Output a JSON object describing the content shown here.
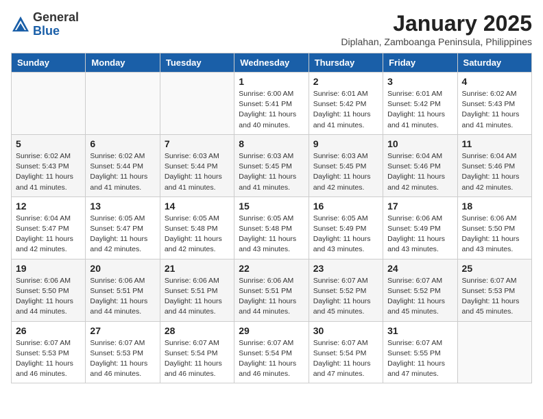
{
  "header": {
    "logo": {
      "general": "General",
      "blue": "Blue"
    },
    "title": "January 2025",
    "location": "Diplahan, Zamboanga Peninsula, Philippines"
  },
  "weekdays": [
    "Sunday",
    "Monday",
    "Tuesday",
    "Wednesday",
    "Thursday",
    "Friday",
    "Saturday"
  ],
  "weeks": [
    [
      {
        "day": "",
        "sunrise": "",
        "sunset": "",
        "daylight": "",
        "empty": true
      },
      {
        "day": "",
        "sunrise": "",
        "sunset": "",
        "daylight": "",
        "empty": true
      },
      {
        "day": "",
        "sunrise": "",
        "sunset": "",
        "daylight": "",
        "empty": true
      },
      {
        "day": "1",
        "sunrise": "Sunrise: 6:00 AM",
        "sunset": "Sunset: 5:41 PM",
        "daylight": "Daylight: 11 hours and 40 minutes."
      },
      {
        "day": "2",
        "sunrise": "Sunrise: 6:01 AM",
        "sunset": "Sunset: 5:42 PM",
        "daylight": "Daylight: 11 hours and 41 minutes."
      },
      {
        "day": "3",
        "sunrise": "Sunrise: 6:01 AM",
        "sunset": "Sunset: 5:42 PM",
        "daylight": "Daylight: 11 hours and 41 minutes."
      },
      {
        "day": "4",
        "sunrise": "Sunrise: 6:02 AM",
        "sunset": "Sunset: 5:43 PM",
        "daylight": "Daylight: 11 hours and 41 minutes."
      }
    ],
    [
      {
        "day": "5",
        "sunrise": "Sunrise: 6:02 AM",
        "sunset": "Sunset: 5:43 PM",
        "daylight": "Daylight: 11 hours and 41 minutes."
      },
      {
        "day": "6",
        "sunrise": "Sunrise: 6:02 AM",
        "sunset": "Sunset: 5:44 PM",
        "daylight": "Daylight: 11 hours and 41 minutes."
      },
      {
        "day": "7",
        "sunrise": "Sunrise: 6:03 AM",
        "sunset": "Sunset: 5:44 PM",
        "daylight": "Daylight: 11 hours and 41 minutes."
      },
      {
        "day": "8",
        "sunrise": "Sunrise: 6:03 AM",
        "sunset": "Sunset: 5:45 PM",
        "daylight": "Daylight: 11 hours and 41 minutes."
      },
      {
        "day": "9",
        "sunrise": "Sunrise: 6:03 AM",
        "sunset": "Sunset: 5:45 PM",
        "daylight": "Daylight: 11 hours and 42 minutes."
      },
      {
        "day": "10",
        "sunrise": "Sunrise: 6:04 AM",
        "sunset": "Sunset: 5:46 PM",
        "daylight": "Daylight: 11 hours and 42 minutes."
      },
      {
        "day": "11",
        "sunrise": "Sunrise: 6:04 AM",
        "sunset": "Sunset: 5:46 PM",
        "daylight": "Daylight: 11 hours and 42 minutes."
      }
    ],
    [
      {
        "day": "12",
        "sunrise": "Sunrise: 6:04 AM",
        "sunset": "Sunset: 5:47 PM",
        "daylight": "Daylight: 11 hours and 42 minutes."
      },
      {
        "day": "13",
        "sunrise": "Sunrise: 6:05 AM",
        "sunset": "Sunset: 5:47 PM",
        "daylight": "Daylight: 11 hours and 42 minutes."
      },
      {
        "day": "14",
        "sunrise": "Sunrise: 6:05 AM",
        "sunset": "Sunset: 5:48 PM",
        "daylight": "Daylight: 11 hours and 42 minutes."
      },
      {
        "day": "15",
        "sunrise": "Sunrise: 6:05 AM",
        "sunset": "Sunset: 5:48 PM",
        "daylight": "Daylight: 11 hours and 43 minutes."
      },
      {
        "day": "16",
        "sunrise": "Sunrise: 6:05 AM",
        "sunset": "Sunset: 5:49 PM",
        "daylight": "Daylight: 11 hours and 43 minutes."
      },
      {
        "day": "17",
        "sunrise": "Sunrise: 6:06 AM",
        "sunset": "Sunset: 5:49 PM",
        "daylight": "Daylight: 11 hours and 43 minutes."
      },
      {
        "day": "18",
        "sunrise": "Sunrise: 6:06 AM",
        "sunset": "Sunset: 5:50 PM",
        "daylight": "Daylight: 11 hours and 43 minutes."
      }
    ],
    [
      {
        "day": "19",
        "sunrise": "Sunrise: 6:06 AM",
        "sunset": "Sunset: 5:50 PM",
        "daylight": "Daylight: 11 hours and 44 minutes."
      },
      {
        "day": "20",
        "sunrise": "Sunrise: 6:06 AM",
        "sunset": "Sunset: 5:51 PM",
        "daylight": "Daylight: 11 hours and 44 minutes."
      },
      {
        "day": "21",
        "sunrise": "Sunrise: 6:06 AM",
        "sunset": "Sunset: 5:51 PM",
        "daylight": "Daylight: 11 hours and 44 minutes."
      },
      {
        "day": "22",
        "sunrise": "Sunrise: 6:06 AM",
        "sunset": "Sunset: 5:51 PM",
        "daylight": "Daylight: 11 hours and 44 minutes."
      },
      {
        "day": "23",
        "sunrise": "Sunrise: 6:07 AM",
        "sunset": "Sunset: 5:52 PM",
        "daylight": "Daylight: 11 hours and 45 minutes."
      },
      {
        "day": "24",
        "sunrise": "Sunrise: 6:07 AM",
        "sunset": "Sunset: 5:52 PM",
        "daylight": "Daylight: 11 hours and 45 minutes."
      },
      {
        "day": "25",
        "sunrise": "Sunrise: 6:07 AM",
        "sunset": "Sunset: 5:53 PM",
        "daylight": "Daylight: 11 hours and 45 minutes."
      }
    ],
    [
      {
        "day": "26",
        "sunrise": "Sunrise: 6:07 AM",
        "sunset": "Sunset: 5:53 PM",
        "daylight": "Daylight: 11 hours and 46 minutes."
      },
      {
        "day": "27",
        "sunrise": "Sunrise: 6:07 AM",
        "sunset": "Sunset: 5:53 PM",
        "daylight": "Daylight: 11 hours and 46 minutes."
      },
      {
        "day": "28",
        "sunrise": "Sunrise: 6:07 AM",
        "sunset": "Sunset: 5:54 PM",
        "daylight": "Daylight: 11 hours and 46 minutes."
      },
      {
        "day": "29",
        "sunrise": "Sunrise: 6:07 AM",
        "sunset": "Sunset: 5:54 PM",
        "daylight": "Daylight: 11 hours and 46 minutes."
      },
      {
        "day": "30",
        "sunrise": "Sunrise: 6:07 AM",
        "sunset": "Sunset: 5:54 PM",
        "daylight": "Daylight: 11 hours and 47 minutes."
      },
      {
        "day": "31",
        "sunrise": "Sunrise: 6:07 AM",
        "sunset": "Sunset: 5:55 PM",
        "daylight": "Daylight: 11 hours and 47 minutes."
      },
      {
        "day": "",
        "sunrise": "",
        "sunset": "",
        "daylight": "",
        "empty": true
      }
    ]
  ]
}
